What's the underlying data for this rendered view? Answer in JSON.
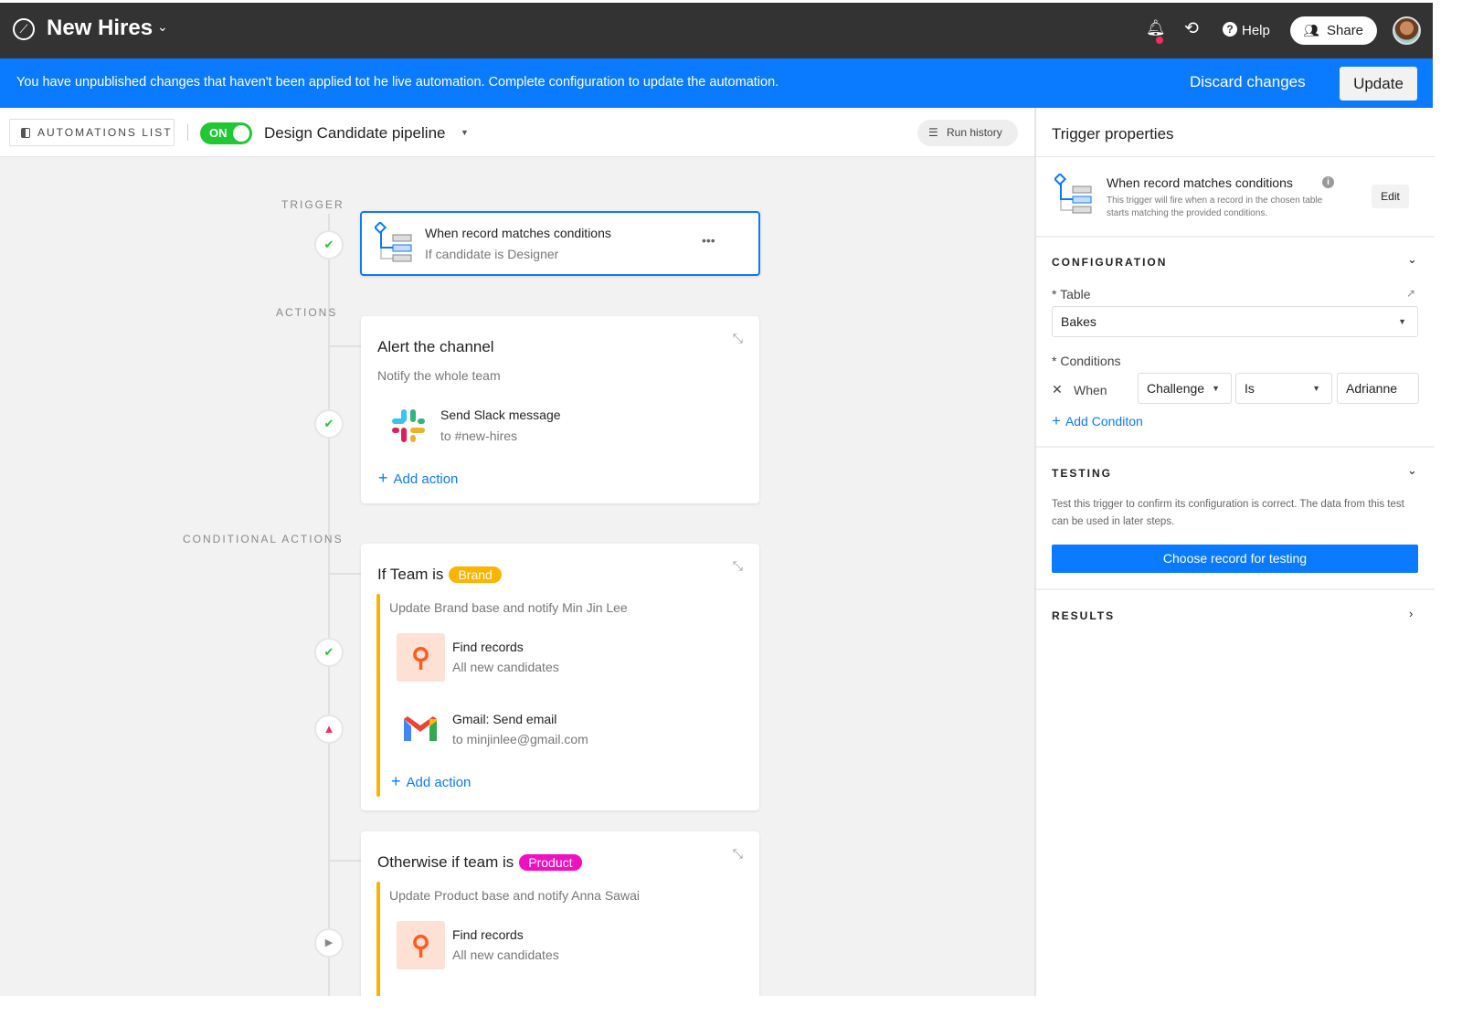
{
  "topbar": {
    "title": "New Hires",
    "help": "Help",
    "share": "Share"
  },
  "banner": {
    "message": "You have unpublished changes that haven't been applied tot he live automation. Complete configuration to update the automation.",
    "discard": "Discard changes",
    "update": "Update"
  },
  "toolbar": {
    "automations_list": "AUTOMATIONS LIST",
    "toggle": "ON",
    "automation_name": "Design Candidate pipeline",
    "run_history": "Run history"
  },
  "canvas": {
    "trigger_label": "TRIGGER",
    "actions_label": "ACTIONS",
    "conditional_label": "CONDITIONAL ACTIONS",
    "trigger": {
      "title": "When record matches conditions",
      "subtitle": "If candidate is Designer"
    },
    "alert": {
      "title": "Alert the channel",
      "subtitle": "Notify the whole team",
      "step_title": "Send Slack message",
      "step_sub": "to #new-hires",
      "add": "Add action"
    },
    "brand": {
      "prefix": "If Team is",
      "tag": "Brand",
      "tag_color": "#fcb400",
      "desc": "Update Brand base and notify Min Jin Lee",
      "step1_title": "Find records",
      "step1_sub": "All new candidates",
      "step2_title": "Gmail: Send email",
      "step2_sub": "to minjinlee@gmail.com",
      "add": "Add action"
    },
    "product": {
      "prefix": "Otherwise if team is",
      "tag": "Product",
      "tag_color": "#f10fc1",
      "desc": "Update Product base and notify Anna Sawai",
      "step1_title": "Find records",
      "step1_sub": "All new candidates"
    }
  },
  "panel": {
    "title": "Trigger properties",
    "trigger_name": "When record matches conditions",
    "trigger_desc": "This trigger will fire when a record in the chosen table starts matching the provided conditions.",
    "edit": "Edit",
    "configuration": "CONFIGURATION",
    "table_label": "* Table",
    "table_value": "Bakes",
    "conditions_label": "* Conditions",
    "when": "When",
    "field": "Challenge",
    "operator": "Is",
    "value": "Adrianne",
    "add_condition": "Add Conditon",
    "testing": "TESTING",
    "testing_desc": "Test this trigger to confirm its configuration is correct. The data from this test can be used in later steps.",
    "choose": "Choose record for testing",
    "results": "RESULTS"
  }
}
